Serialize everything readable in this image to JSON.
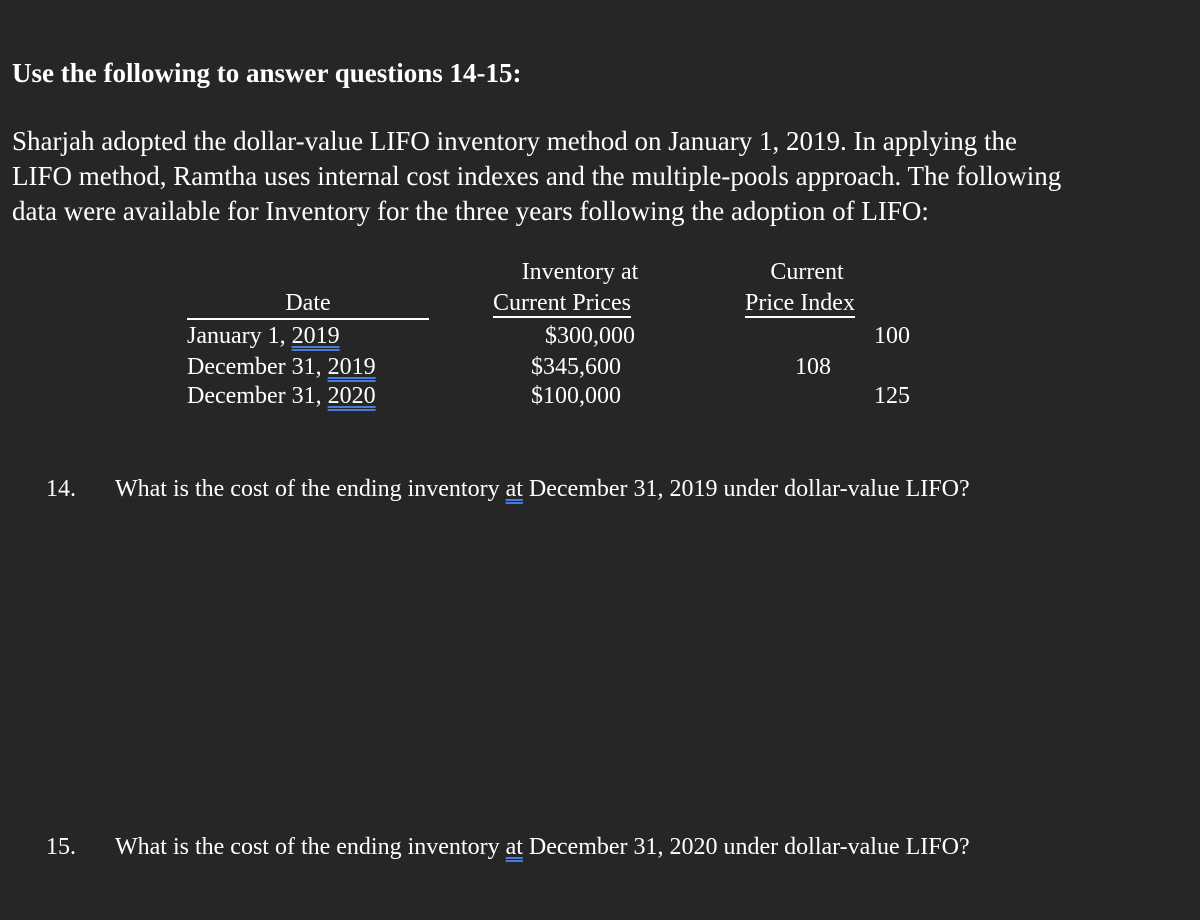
{
  "heading": "Use the following to answer questions 14-15:",
  "paragraph": [
    "Sharjah adopted the dollar-value LIFO inventory method on January 1, 2019. In applying the",
    "LIFO method, Ramtha uses internal cost indexes and the multiple-pools approach. The following",
    "data were available for Inventory for the three years following the adoption of LIFO:"
  ],
  "table": {
    "headers": {
      "date": "Date",
      "inventory_line1": "Inventory at",
      "inventory_line2": "Current Prices",
      "index_line1": "Current",
      "index_line2": "Price Index"
    },
    "rows": [
      {
        "date_prefix": "January 1, ",
        "year": "2019",
        "inventory": "$300,000",
        "index": "100"
      },
      {
        "date_prefix": "December 31, ",
        "year": "2019",
        "inventory": "$345,600",
        "index": "108"
      },
      {
        "date_prefix": "December 31, ",
        "year": "2020",
        "inventory": "$100,000",
        "index": "125"
      }
    ]
  },
  "questions": [
    {
      "number": "14.",
      "before": "What is the cost of the ending inventory ",
      "at": "at",
      "after": " December 31, 2019 under dollar-value LIFO?"
    },
    {
      "number": "15.",
      "before": "What is the cost of the ending inventory ",
      "at": "at",
      "after": " December 31, 2020 under dollar-value LIFO?"
    }
  ]
}
